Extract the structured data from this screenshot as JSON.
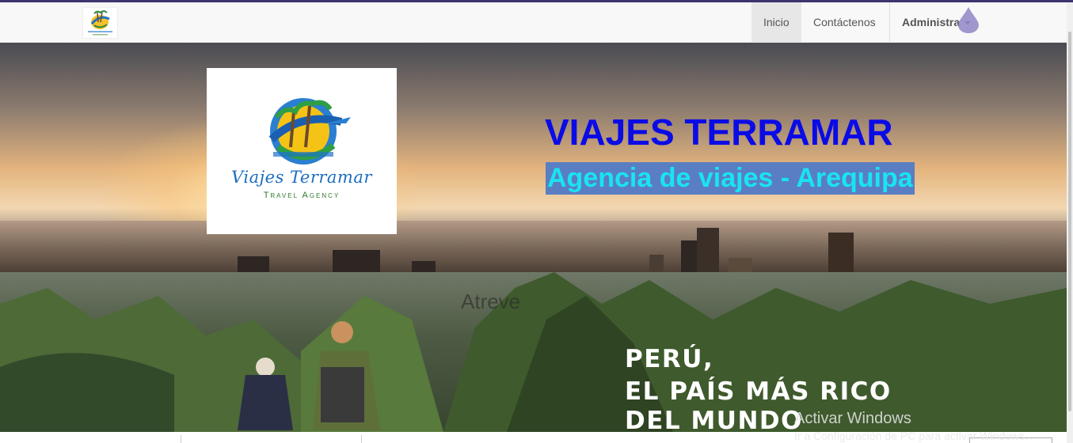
{
  "navbar": {
    "brand_logo_text": "Viajes Terramar",
    "items": [
      {
        "label": "Inicio"
      },
      {
        "label": "Contáctenos"
      },
      {
        "label": "Administra"
      }
    ]
  },
  "hero": {
    "logo_text": "Viajes Terramar",
    "logo_subtext": "Travel Agency",
    "title": "VIAJES TERRAMAR",
    "subtitle": "Agencia de viajes - Arequipa"
  },
  "promo": {
    "faded_text": "Atreve",
    "lines": [
      "PERÚ,",
      "EL PAÍS MÁS RICO",
      "DEL MUNDO"
    ]
  },
  "watermark": {
    "line1": "Activar Windows",
    "line2": "Ir a Configuración de PC para activar Windows."
  },
  "colors": {
    "title": "#0b0be6",
    "subtitle": "#19e4f0",
    "subtitle_bg": "#5a7ec2",
    "active_nav_bg": "#e7e7e7"
  }
}
